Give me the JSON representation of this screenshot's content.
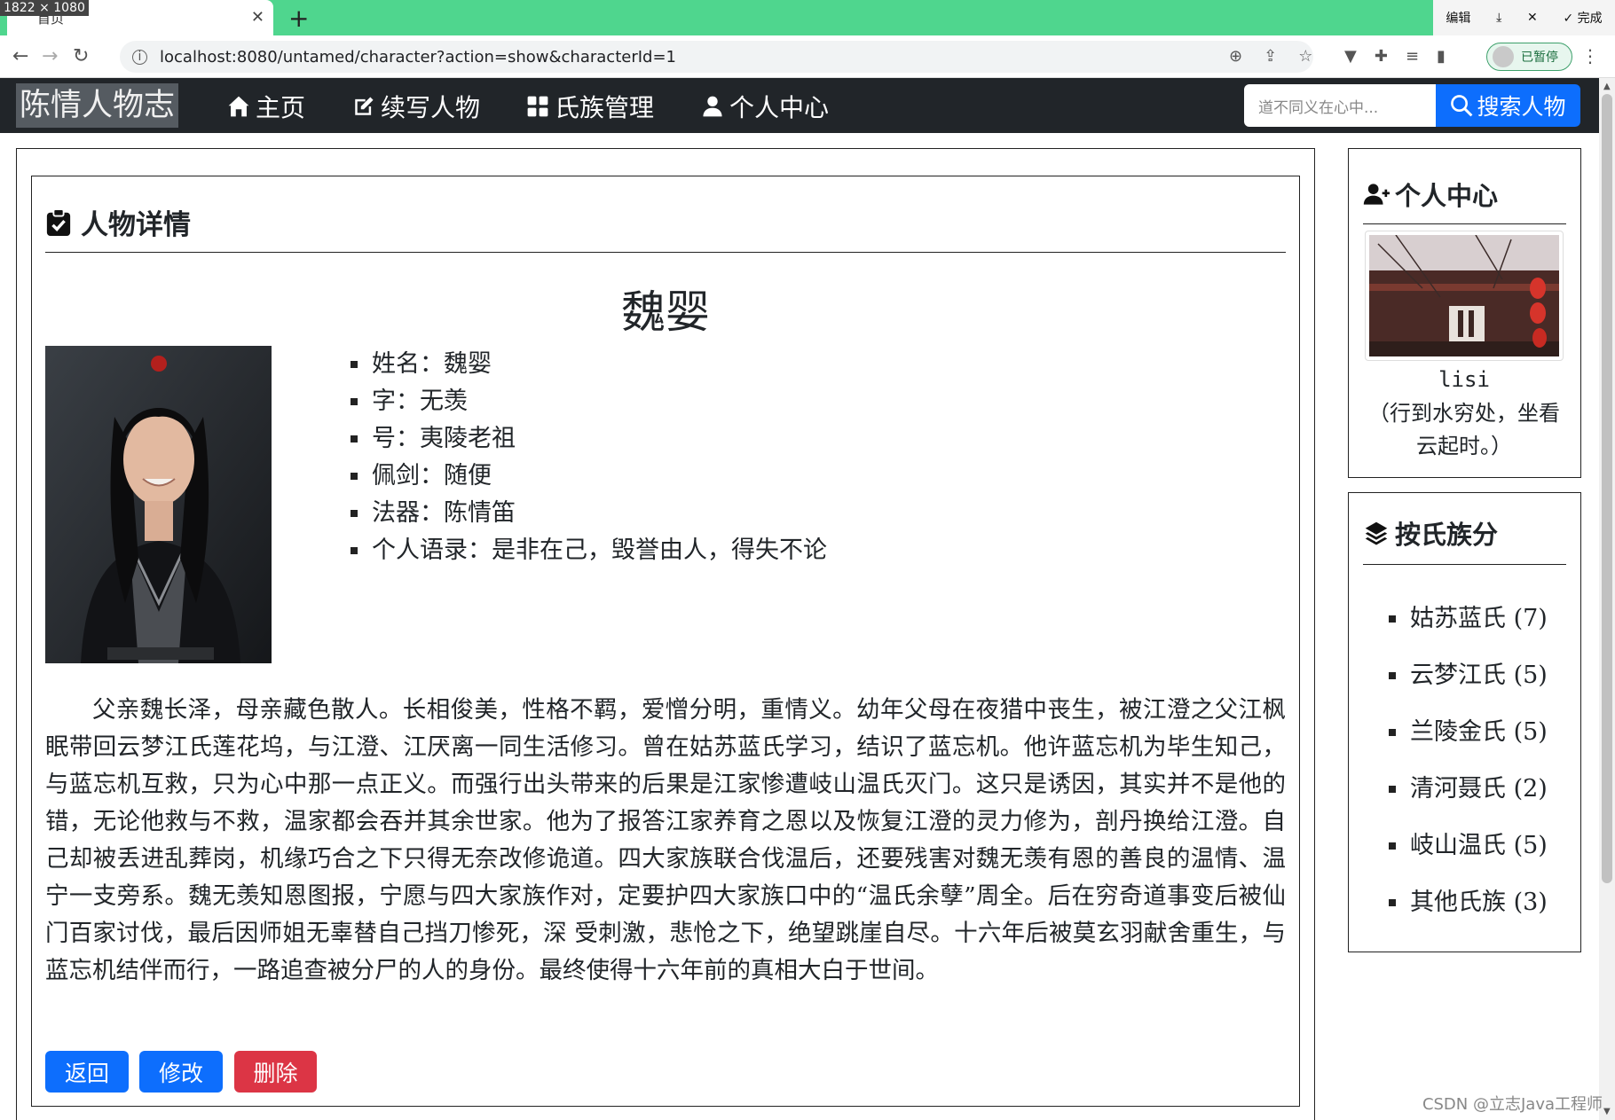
{
  "browser": {
    "dimensions_badge": "1822 × 1080",
    "tab_title": "首页",
    "url": "localhost:8080/untamed/character?action=show&characterId=1",
    "profile_status": "已暂停",
    "edit_label": "编辑",
    "done_label": "完成",
    "accent_color": "#4fd68e"
  },
  "navbar": {
    "brand": "陈情人物志",
    "links": [
      {
        "label": "主页",
        "icon": "house-icon"
      },
      {
        "label": "续写人物",
        "icon": "pencil-square-icon"
      },
      {
        "label": "氏族管理",
        "icon": "grid-icon"
      },
      {
        "label": "个人中心",
        "icon": "person-icon"
      }
    ],
    "search_placeholder": "道不同义在心中...",
    "search_button": "搜索人物"
  },
  "main": {
    "heading": "人物详情",
    "character_name": "魏婴",
    "info": [
      "姓名：魏婴",
      "字：无羡",
      "号：夷陵老祖",
      "佩剑：随便",
      "法器：陈情笛",
      "个人语录：是非在己，毁誉由人，得失不论"
    ],
    "bio": "父亲魏长泽，母亲藏色散人。长相俊美，性格不羁，爱憎分明，重情义。幼年父母在夜猎中丧生，被江澄之父江枫眠带回云梦江氏莲花坞，与江澄、江厌离一同生活修习。曾在姑苏蓝氏学习，结识了蓝忘机。他许蓝忘机为毕生知己，与蓝忘机互救，只为心中那一点正义。而强行出头带来的后果是江家惨遭岐山温氏灭门。这只是诱因，其实并不是他的错，无论他救与不救，温家都会吞并其余世家。他为了报答江家养育之恩以及恢复江澄的灵力修为，剖丹换给江澄。自己却被丢进乱葬岗，机缘巧合之下只得无奈改修诡道。四大家族联合伐温后，还要残害对魏无羡有恩的善良的温情、温宁一支旁系。魏无羡知恩图报，宁愿与四大家族作对，定要护四大家族口中的“温氏余孽”周全。后在穷奇道事变后被仙门百家讨伐，最后因师姐无辜替自己挡刀惨死，深 受刺激，悲怆之下，绝望跳崖自尽。十六年后被莫玄羽献舍重生，与蓝忘机结伴而行，一路追查被分尸的人的身份。最终使得十六年前的真相大白于世间。",
    "buttons": {
      "back": "返回",
      "edit": "修改",
      "delete": "删除"
    },
    "colors": {
      "primary": "#0d6efd",
      "danger": "#dc3545"
    }
  },
  "sidebar": {
    "profile": {
      "heading": "个人中心",
      "username": "lisi",
      "motto": "（行到水穷处，坐看云起时。）"
    },
    "clans": {
      "heading": "按氏族分",
      "items": [
        "姑苏蓝氏 (7)",
        "云梦江氏 (5)",
        "兰陵金氏 (5)",
        "清河聂氏 (2)",
        "岐山温氏 (5)",
        "其他氏族 (3)"
      ]
    }
  },
  "watermark": "CSDN @立志Java工程师"
}
